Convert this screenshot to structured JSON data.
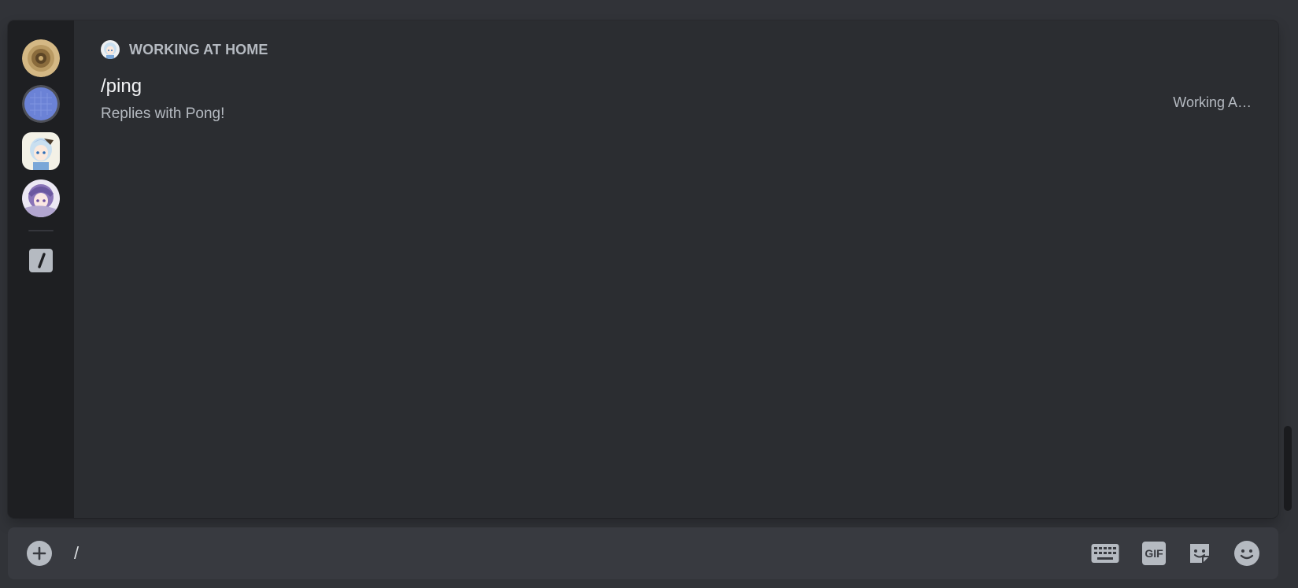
{
  "autocomplete": {
    "section": {
      "title": "WORKING AT HOME",
      "icon": "app-avatar-icon"
    },
    "commands": [
      {
        "name": "/ping",
        "description": "Replies with Pong!",
        "app": "Working A…"
      }
    ],
    "rail_icons": [
      "server-avatar-1",
      "server-avatar-2",
      "bot-avatar-1",
      "bot-avatar-2",
      "slash-command-icon"
    ]
  },
  "composer": {
    "value": "/",
    "attach_icon": "plus-circle-icon",
    "tools": [
      "keyboard-icon",
      "gif-icon",
      "sticker-icon",
      "emoji-icon"
    ],
    "gif_label": "GIF"
  },
  "colors": {
    "background": "#313338",
    "popup": "#2b2d31",
    "rail": "#1e1f22",
    "composer": "#383a40",
    "muted_text": "#b5bac1",
    "primary_text": "#f2f3f5"
  }
}
